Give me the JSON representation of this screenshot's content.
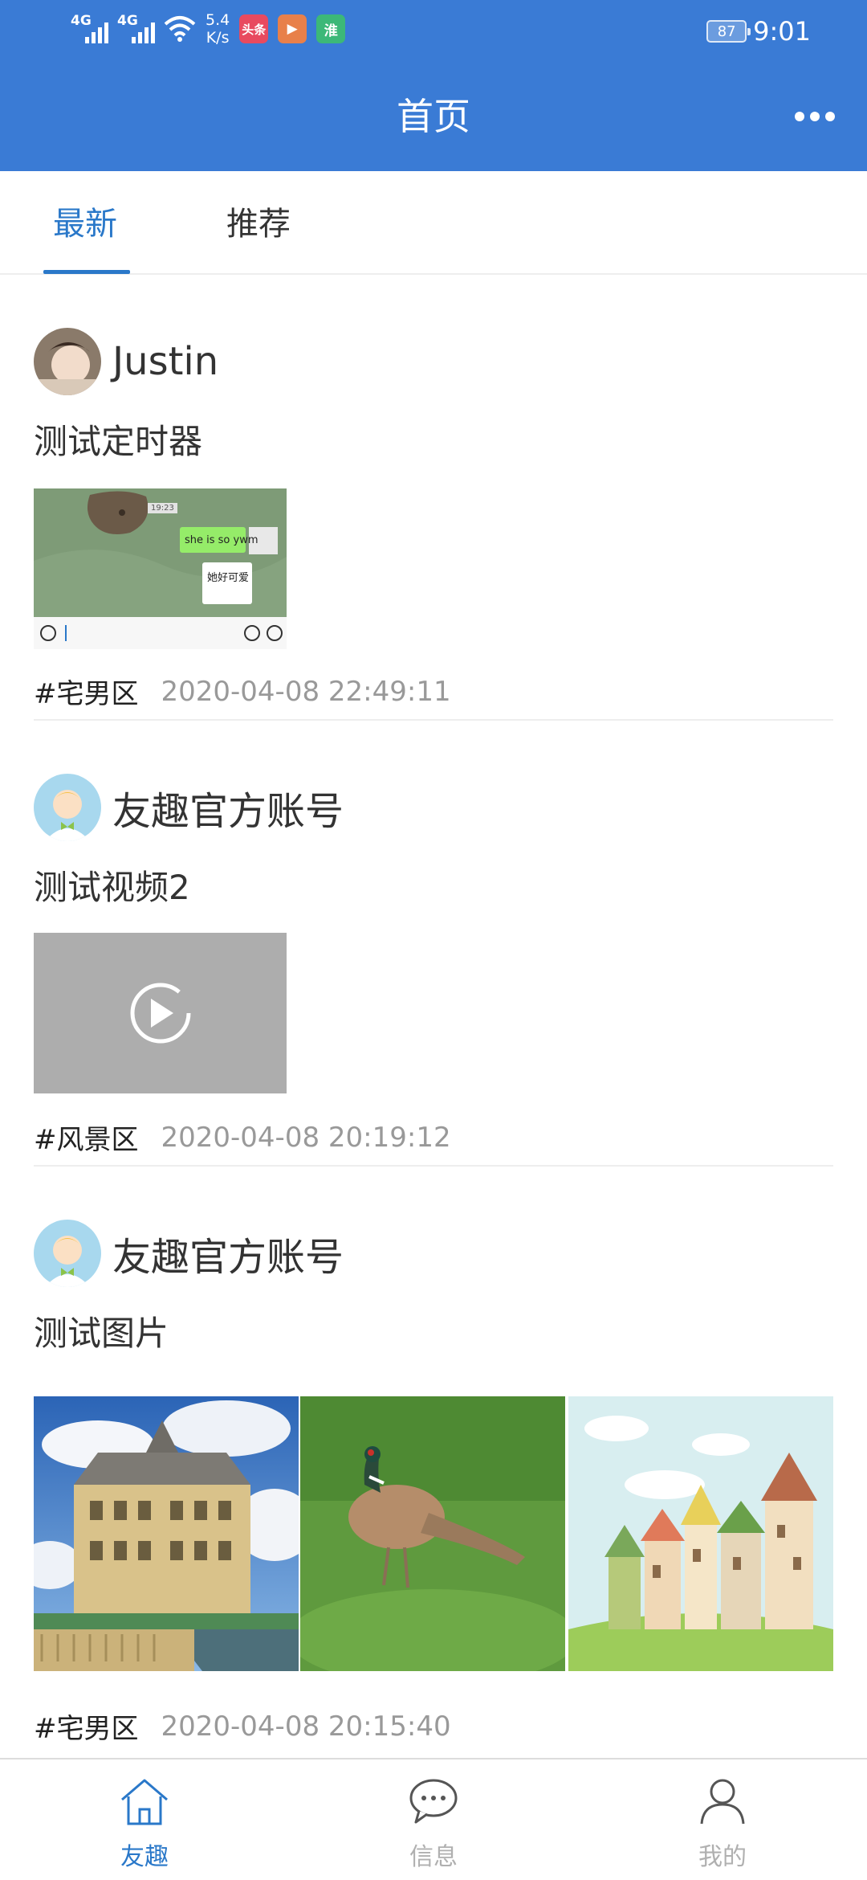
{
  "status_bar": {
    "signal1_tag": "4G",
    "signal2_tag": "4G",
    "speed_value": "5.4",
    "speed_unit": "K/s",
    "app_icons": [
      {
        "name": "toutiao-app-icon",
        "label": "头条",
        "color": "#e84a5f"
      },
      {
        "name": "video-app-icon",
        "label": "▶",
        "color": "#e8804a"
      },
      {
        "name": "huai-app-icon",
        "label": "淮",
        "color": "#3cb878"
      }
    ],
    "battery": "87",
    "time": "9:01"
  },
  "header": {
    "title": "首页",
    "color": "#3a7bd5"
  },
  "tabs": [
    {
      "label": "最新",
      "active": true
    },
    {
      "label": "推荐",
      "active": false
    }
  ],
  "posts": [
    {
      "username": "Justin",
      "text": "测试定时器",
      "media_type": "screenshot",
      "screenshot": {
        "time_label": "19:23",
        "bubble_text": "she is so ywm",
        "card_text": "她好可爱"
      },
      "topic": "#宅男区",
      "time": "2020-04-08 22:49:11"
    },
    {
      "username": "友趣官方账号",
      "text": "测试视频2",
      "media_type": "video",
      "topic": "#风景区",
      "time": "2020-04-08 20:19:12"
    },
    {
      "username": "友趣官方账号",
      "text": "测试图片",
      "media_type": "images",
      "images": [
        "castle-photo",
        "pheasant-photo",
        "cartoon-houses-photo"
      ],
      "topic": "#宅男区",
      "time": "2020-04-08 20:15:40"
    }
  ],
  "bottom_nav": [
    {
      "label": "友趣",
      "icon": "home-icon",
      "active": true
    },
    {
      "label": "信息",
      "icon": "chat-icon",
      "active": false
    },
    {
      "label": "我的",
      "icon": "user-icon",
      "active": false
    }
  ],
  "colors": {
    "accent": "#2a78c9",
    "muted": "#999999",
    "nav_inactive": "#b0b0b0"
  }
}
